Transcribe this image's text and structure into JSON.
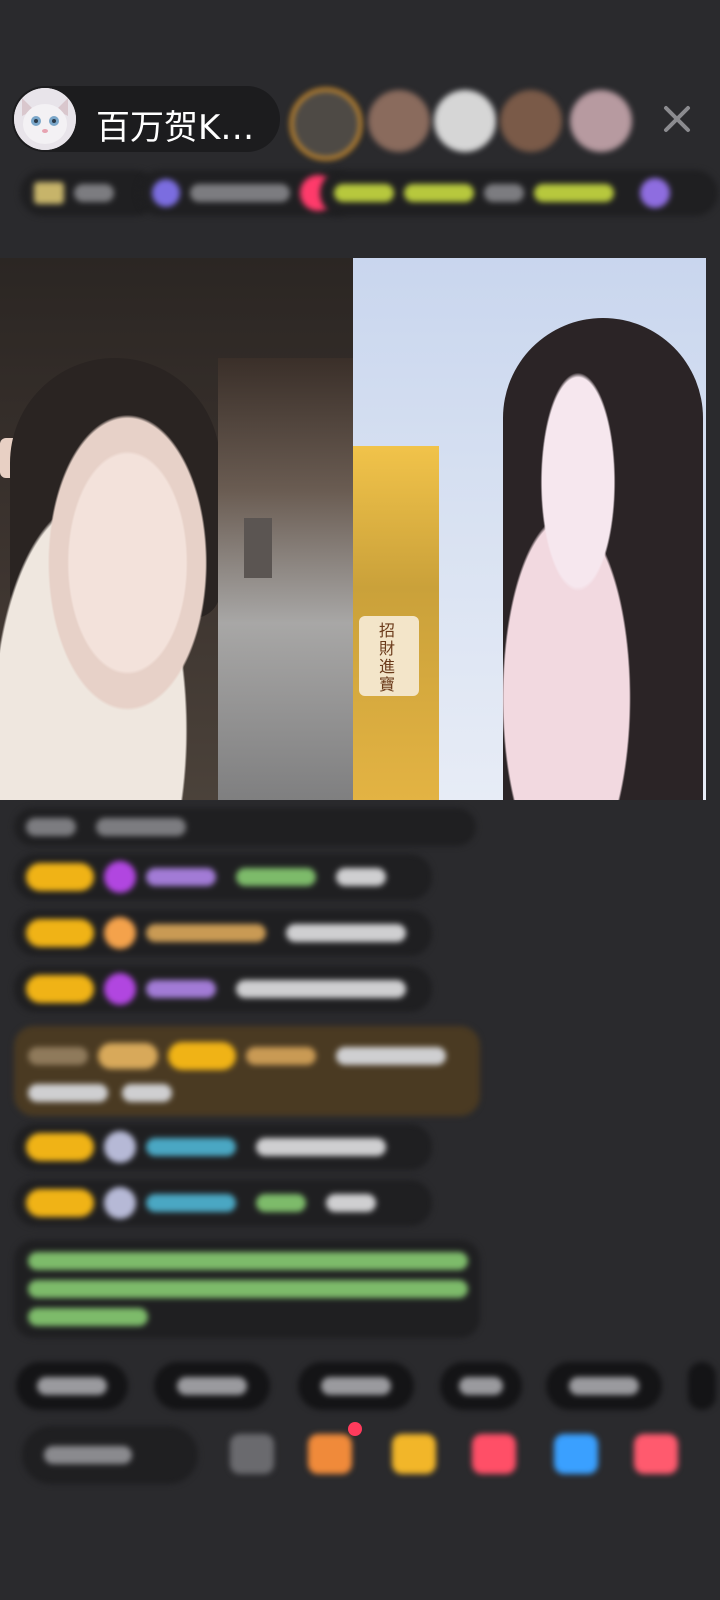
{
  "header": {
    "host_name": "百万贺K…",
    "close_icon": "close-icon"
  },
  "colors": {
    "background": "#2a2a2d",
    "badge_gold": "#f0b316",
    "gem_purple": "#b146e0",
    "brown_message": "#4a3a22"
  },
  "video": {
    "left_scroll_text": "招財進寶"
  }
}
